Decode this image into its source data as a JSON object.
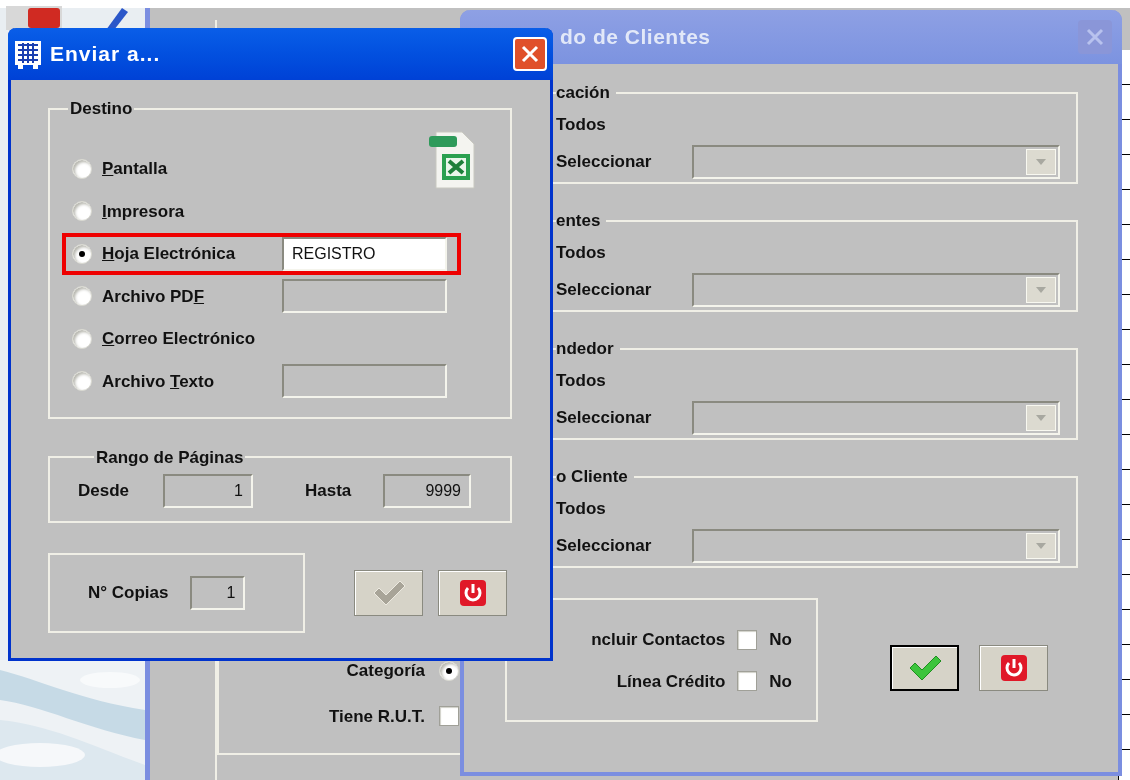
{
  "background_form": {
    "category": {
      "label": "Categoría",
      "selected": true
    },
    "has_rut": {
      "label": "Tiene R.U.T.",
      "checked": false
    }
  },
  "back_window": {
    "title": "do de Clientes",
    "active": false,
    "sections": [
      {
        "title": "cación",
        "all_label": "Todos",
        "select_label": "Seleccionar"
      },
      {
        "title": "entes",
        "all_label": "Todos",
        "select_label": "Seleccionar"
      },
      {
        "title": "ndedor",
        "all_label": "Todos",
        "select_label": "Seleccionar"
      },
      {
        "title": "o Cliente",
        "all_label": "Todos",
        "select_label": "Seleccionar"
      }
    ],
    "options": [
      {
        "label": "ncluir Contactos",
        "checked": false,
        "value": "No"
      },
      {
        "label": "Línea Crédito",
        "checked": false,
        "value": "No"
      }
    ],
    "buttons": [
      {
        "kind": "accept",
        "focused": true,
        "disabled": false
      },
      {
        "kind": "exit",
        "focused": false,
        "disabled": false
      }
    ]
  },
  "front_window": {
    "title": "Enviar a...",
    "active": true,
    "destination": {
      "title": "Destino",
      "options": [
        {
          "key": "P",
          "after": "antalla",
          "selected": false,
          "highlighted": false
        },
        {
          "key": "I",
          "after": "mpresora",
          "selected": false,
          "highlighted": false
        },
        {
          "key": "H",
          "after": "oja Electrónica",
          "selected": true,
          "highlighted": true,
          "field": {
            "value": "REGISTRO",
            "disabled": false
          }
        },
        {
          "before": "Archivo PD",
          "key": "F",
          "selected": false,
          "highlighted": false,
          "field": {
            "disabled": true
          }
        },
        {
          "key": "C",
          "after": "orreo Electrónico",
          "selected": false,
          "highlighted": false
        },
        {
          "before": "Archivo ",
          "key": "T",
          "after": "exto",
          "selected": false,
          "highlighted": false,
          "field": {
            "disabled": true
          }
        }
      ]
    },
    "page_range": {
      "title": "Rango de Páginas",
      "from_label": "Desde",
      "from_value": "1",
      "to_label": "Hasta",
      "to_value": "9999"
    },
    "copies": {
      "label": "N° Copias",
      "value": "1"
    },
    "buttons": [
      {
        "kind": "accept",
        "focused": false,
        "disabled": true
      },
      {
        "kind": "exit",
        "focused": false,
        "disabled": false
      }
    ]
  }
}
